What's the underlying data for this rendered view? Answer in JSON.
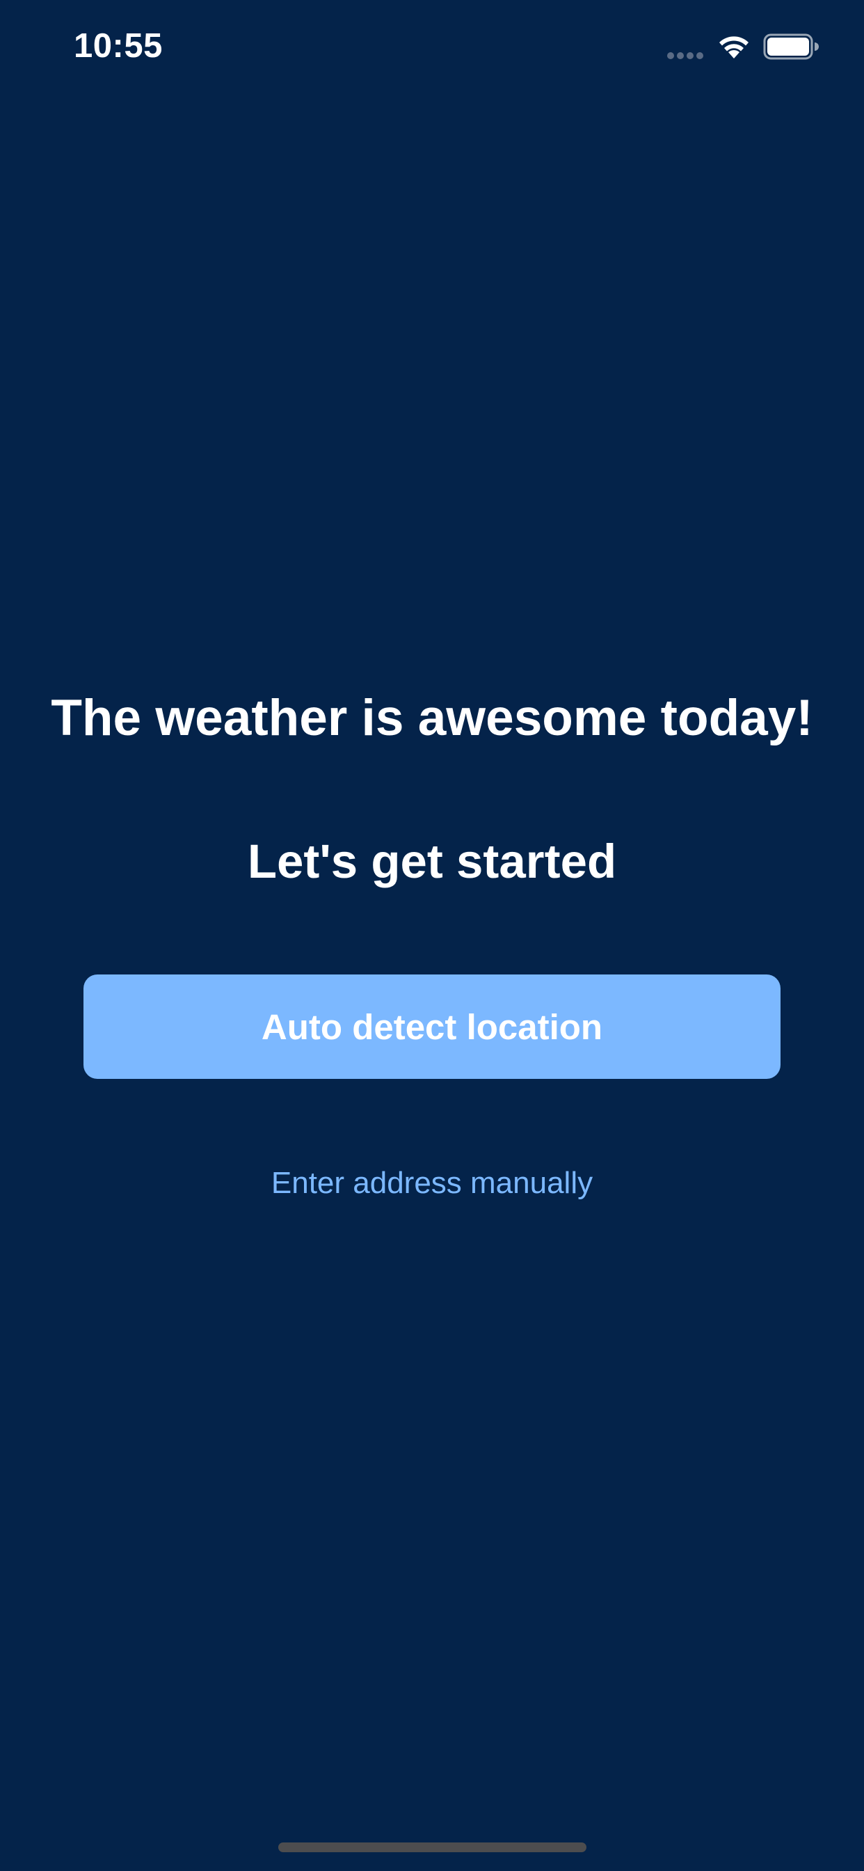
{
  "status_bar": {
    "time": "10:55",
    "icons": [
      "signal-dots-icon",
      "wifi-icon",
      "battery-icon"
    ]
  },
  "onboarding": {
    "headline": "The weather is awesome today!",
    "subheadline": "Let's get started",
    "primary_button_label": "Auto detect location",
    "secondary_link_label": "Enter address manually"
  },
  "colors": {
    "background": "#04234a",
    "accent": "#7cb8ff",
    "text": "#ffffff",
    "home_indicator": "#4d4d4f"
  }
}
